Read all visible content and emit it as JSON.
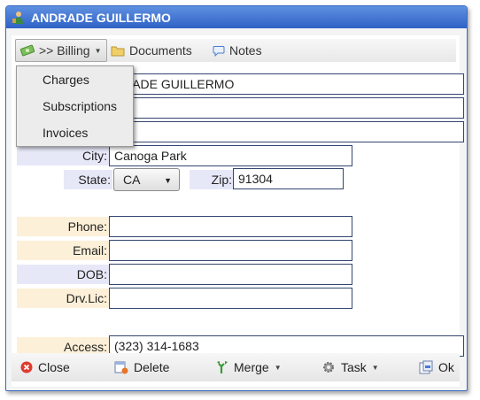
{
  "window": {
    "title": "ANDRADE GUILLERMO"
  },
  "toolbar": {
    "billing_label": ">> Billing",
    "documents_label": "Documents",
    "notes_label": "Notes"
  },
  "billing_menu": {
    "items": [
      "Charges",
      "Subscriptions",
      "Invoices"
    ]
  },
  "form": {
    "name_value": "ANDRADE GUILLERMO",
    "name_visible_text": "DRADE GUILLERMO",
    "address1_value": "",
    "address2_value": "",
    "city_label": "City:",
    "city_value": "Canoga Park",
    "state_label": "State:",
    "state_value": "CA",
    "zip_label": "Zip:",
    "zip_value": "91304",
    "phone_label": "Phone:",
    "phone_value": "",
    "email_label": "Email:",
    "email_value": "",
    "dob_label": "DOB:",
    "dob_value": "",
    "drvlic_label": "Drv.Lic:",
    "drvlic_value": "",
    "access_label": "Access:",
    "access_value": "(323) 314-1683"
  },
  "footer": {
    "close_label": "Close",
    "delete_label": "Delete",
    "merge_label": "Merge",
    "task_label": "Task",
    "ok_label": "Ok"
  },
  "colors": {
    "title_bar": "#2f62c6",
    "label_blue_bg": "#e6e8f8",
    "label_orange_bg": "#fdf0d8",
    "field_border": "#33466f"
  }
}
